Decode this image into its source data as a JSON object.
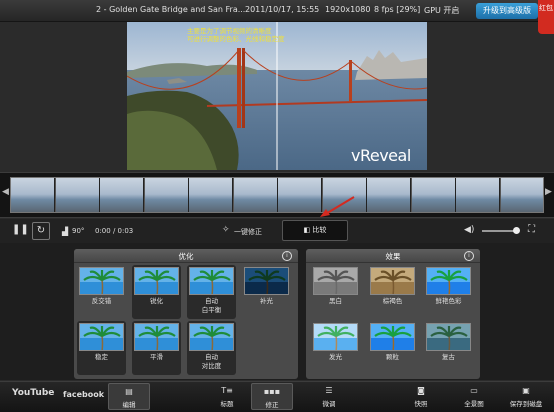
{
  "title_bar": {
    "filename": "2 - Golden Gate Bridge and San Fra...",
    "date": "2011/10/17, 15:55",
    "resolution": "1920x1080",
    "fps": "8 fps [29%]",
    "gpu": "GPU 开启",
    "upgrade_label": "升级到高级版",
    "red_badge": "红包"
  },
  "video": {
    "overlay_line1": "主要是为了调节视频的清晰度",
    "overlay_line2": "可进行调整的色彩、光线和稳定度",
    "logo": "vReveal"
  },
  "controls": {
    "rotate_label": "90°",
    "time": "0:00 / 0:03",
    "auto_fix_label": "一键修正",
    "compare_label": "比较"
  },
  "panels": {
    "optimize": {
      "title": "优化",
      "tiles": [
        {
          "label": "反交错",
          "selected": false
        },
        {
          "label": "锐化",
          "selected": true
        },
        {
          "label": "自动\n白平衡",
          "selected": true
        },
        {
          "label": "补光",
          "selected": false
        },
        {
          "label": "稳定",
          "selected": true
        },
        {
          "label": "平滑",
          "selected": true
        },
        {
          "label": "自动\n对比度",
          "selected": true
        }
      ]
    },
    "effects": {
      "title": "效果",
      "tiles": [
        {
          "label": "黑白"
        },
        {
          "label": "棕褐色"
        },
        {
          "label": "鲜艳色彩"
        },
        {
          "label": "发光"
        },
        {
          "label": "颗粒"
        },
        {
          "label": "复古"
        }
      ]
    }
  },
  "bottom_bar": {
    "youtube": "YouTube",
    "facebook": "facebook",
    "tabs": [
      {
        "label": "编辑",
        "active": true
      },
      {
        "label": "标题",
        "active": false
      },
      {
        "label": "修正",
        "active": true
      },
      {
        "label": "微调",
        "active": false
      },
      {
        "label": "快照",
        "active": false
      },
      {
        "label": "全景图",
        "active": false
      },
      {
        "label": "保存到磁盘",
        "active": false
      }
    ]
  },
  "colors": {
    "accent_blue": "#2a88c8",
    "overlay_yellow": "#f0e13a",
    "red_arrow": "#d42a20"
  }
}
